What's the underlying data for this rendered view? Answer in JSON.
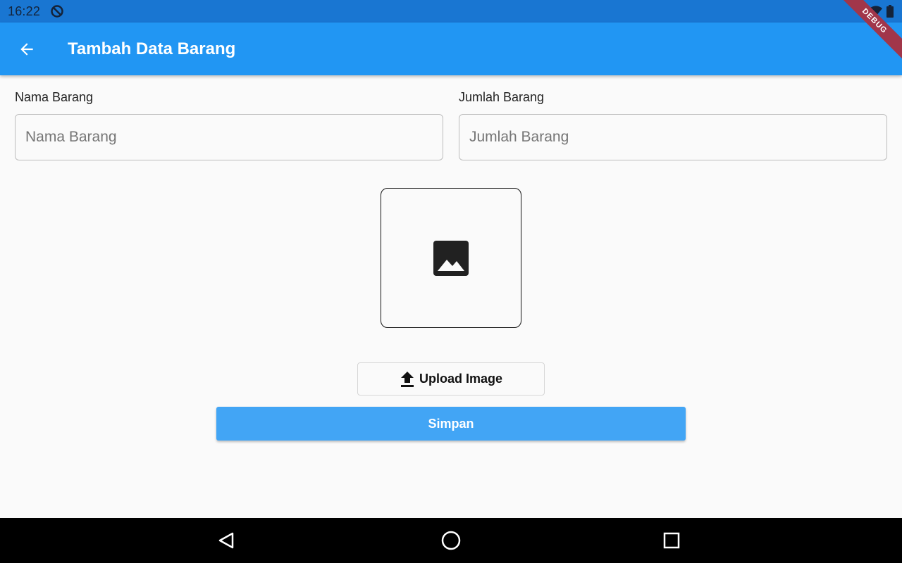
{
  "status_bar": {
    "time": "16:22"
  },
  "debug_banner": {
    "label": "DEBUG"
  },
  "app_bar": {
    "title": "Tambah Data Barang"
  },
  "form": {
    "nama_barang": {
      "label": "Nama Barang",
      "placeholder": "Nama Barang",
      "value": ""
    },
    "jumlah_barang": {
      "label": "Jumlah Barang",
      "placeholder": "Jumlah Barang",
      "value": ""
    }
  },
  "image_preview": {
    "icon": "image-icon"
  },
  "upload_button": {
    "label": "Upload Image",
    "icon": "upload-icon"
  },
  "save_button": {
    "label": "Simpan"
  },
  "colors": {
    "status_bar": "#1976d2",
    "app_bar": "#2196f3",
    "save_button": "#42a5f5",
    "debug_ribbon": "#a1364a",
    "nav_bar": "#000000"
  }
}
